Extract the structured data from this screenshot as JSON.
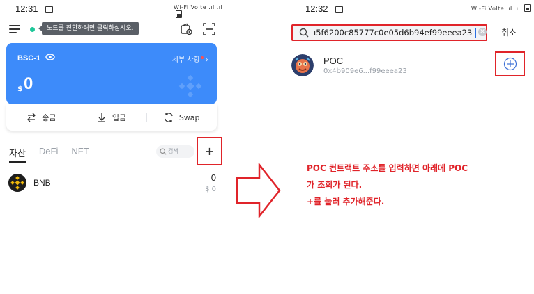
{
  "left": {
    "status": {
      "time": "12:31",
      "signal_text": "Wi-Fi  Volte .ıl .ıl"
    },
    "header": {
      "tooltip": "노드를 전환하려면 클릭하십시오."
    },
    "card": {
      "network": "BSC-1",
      "detail": "세부 사항",
      "currency": "$",
      "balance": "0"
    },
    "actions": [
      {
        "label": "송금",
        "icon": "send-icon"
      },
      {
        "label": "입금",
        "icon": "receive-icon"
      },
      {
        "label": "Swap",
        "icon": "swap-icon"
      }
    ],
    "tabs": [
      {
        "label": "자산",
        "active": true
      },
      {
        "label": "DeFi",
        "active": false
      },
      {
        "label": "NFT",
        "active": false
      }
    ],
    "search_placeholder": "검색",
    "add_label": "+",
    "assets": [
      {
        "name": "BNB",
        "amount": "0",
        "value": "$ 0"
      }
    ]
  },
  "right": {
    "status": {
      "time": "12:32",
      "signal_text": "Wi-Fi  Volte .ıl .ıl"
    },
    "search_value": "ı5f6200c85777c0e05d6b94ef99eeea23",
    "cancel_label": "취소",
    "result": {
      "name": "POC",
      "address": "0x4b909e6...f99eeea23"
    },
    "note_lines": [
      "POC 컨트랙트 주소를 입력하면 아래에 POC",
      "가 조회가 된다.",
      "+를 눌러 추가해준다."
    ]
  },
  "colors": {
    "card_blue": "#3d8bfa",
    "highlight_red": "#e0242a",
    "status_green": "#1fc79a"
  }
}
